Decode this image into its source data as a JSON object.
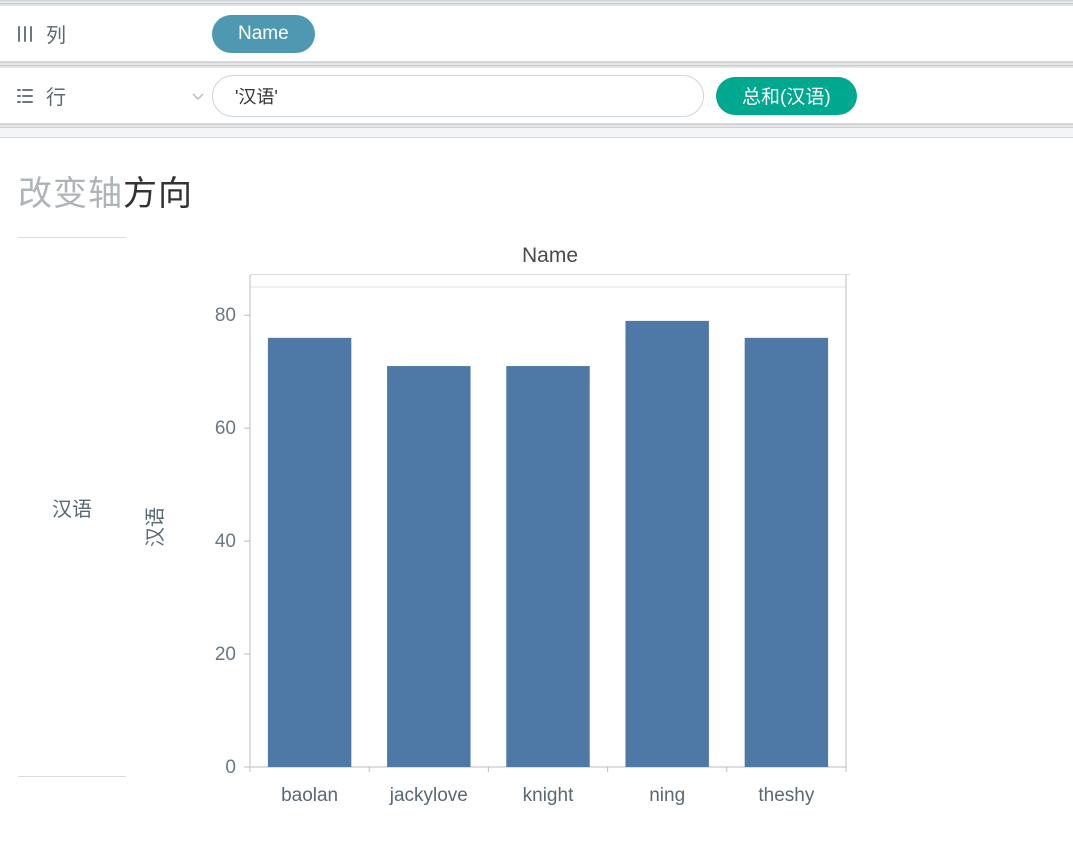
{
  "shelves": {
    "columns": {
      "label": "列",
      "pill": "Name"
    },
    "rows": {
      "label": "行",
      "input_value": "'汉语'",
      "pill": "总和(汉语)"
    }
  },
  "chart": {
    "title_light": "改变轴",
    "title_dark": "方向",
    "row_header": "汉语",
    "col_header": "Name",
    "y_axis_title": "汉语"
  },
  "chart_data": {
    "type": "bar",
    "categories": [
      "baolan",
      "jackylove",
      "knight",
      "ning",
      "theshy"
    ],
    "values": [
      76,
      71,
      71,
      79,
      76
    ],
    "xlabel": "Name",
    "ylabel": "汉语",
    "title": "改变轴方向",
    "ylim": [
      0,
      85
    ],
    "y_ticks": [
      0,
      20,
      40,
      60,
      80
    ]
  }
}
